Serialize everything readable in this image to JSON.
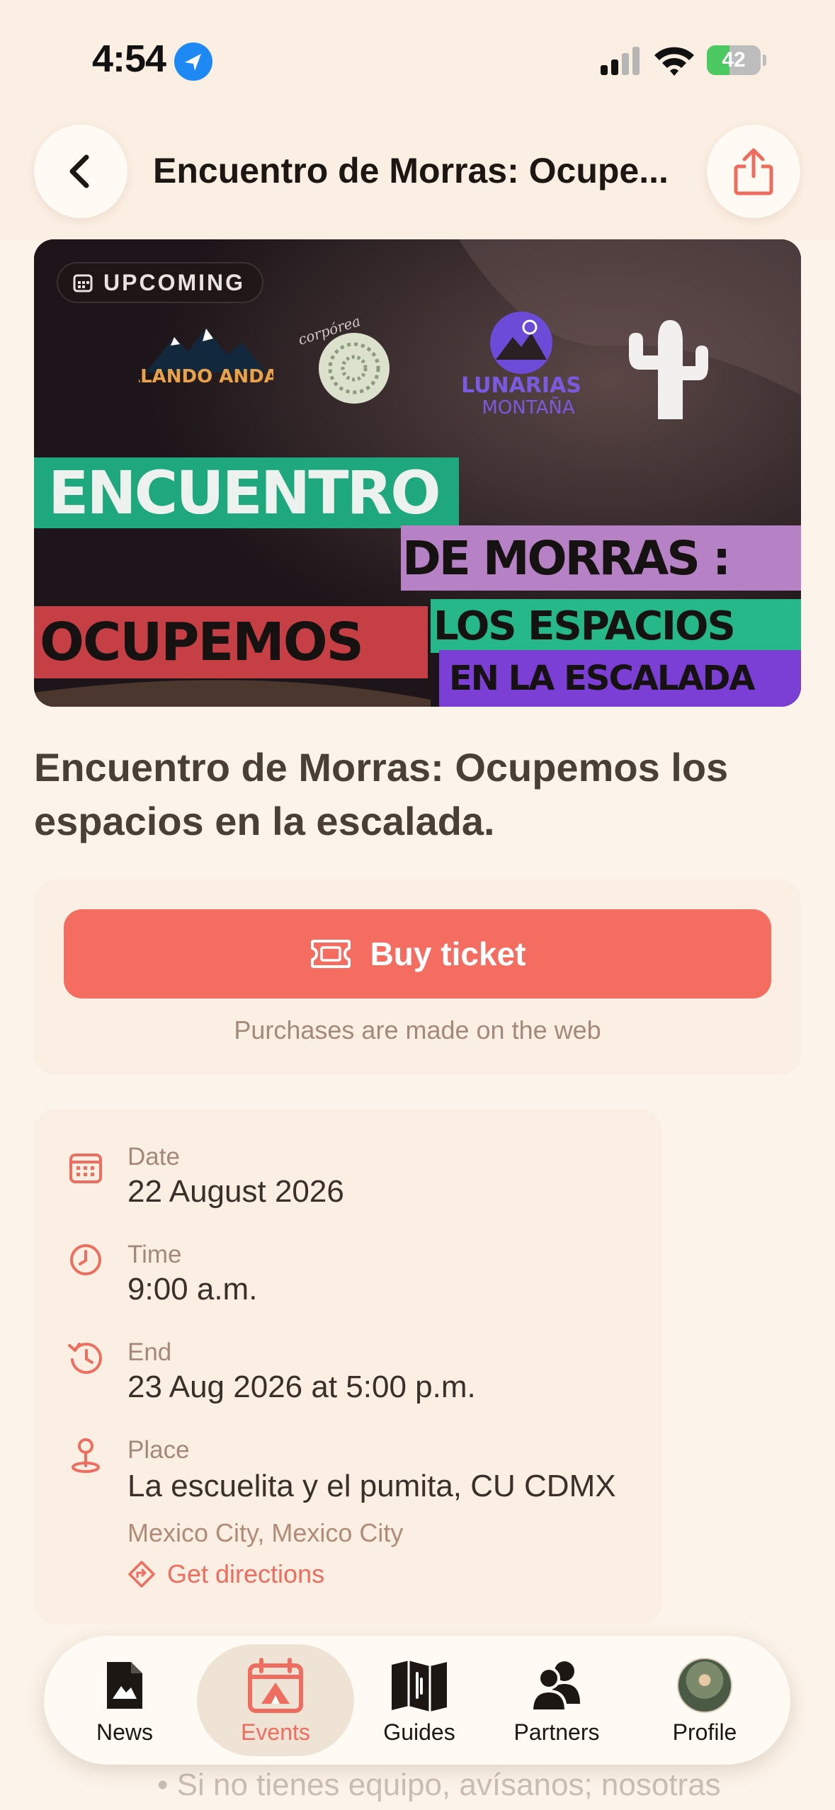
{
  "status_bar": {
    "time": "4:54",
    "battery": "42",
    "battery_level": 0.42
  },
  "header": {
    "title": "Encuentro de Morras: Ocupe..."
  },
  "hero": {
    "badge": "UPCOMING",
    "logos": {
      "escalando": "ESCALANDO ANDAMOS",
      "corporea": "corpórea",
      "lunarias_top": "LUNARIAS",
      "lunarias_bottom": "MONTAÑA"
    },
    "stripes": {
      "line1": "ENCUENTRO",
      "line2": "DE MORRAS :",
      "line3": "OCUPEMOS",
      "line4": "LOS ESPACIOS",
      "line5": "EN LA ESCALADA"
    },
    "colors": {
      "green": "#1fa77d",
      "lilac": "#b781c6",
      "red": "#c63f45",
      "teal": "#26b888",
      "purple": "#7b3fd6"
    }
  },
  "event": {
    "title": "Encuentro de Morras: Ocupemos los espacios en la escalada."
  },
  "ticket": {
    "button_label": "Buy ticket",
    "note": "Purchases are made on the web"
  },
  "details": {
    "date_label": "Date",
    "date_value": "22 August 2026",
    "time_label": "Time",
    "time_value": "9:00 a.m.",
    "end_label": "End",
    "end_value": "23 Aug 2026 at 5:00 p.m.",
    "place_label": "Place",
    "place_value": "La escuelita y el pumita, CU CDMX",
    "place_city": "Mexico City, Mexico City",
    "directions_label": "Get directions"
  },
  "peek": {
    "text": "• Si no tienes equipo, avísanos; nosotras"
  },
  "tabs": [
    {
      "label": "News",
      "icon": "news-icon"
    },
    {
      "label": "Events",
      "icon": "events-icon",
      "active": true
    },
    {
      "label": "Guides",
      "icon": "guides-icon"
    },
    {
      "label": "Partners",
      "icon": "partners-icon"
    },
    {
      "label": "Profile",
      "icon": "profile-avatar"
    }
  ],
  "theme": {
    "accent": "#f46d60",
    "background": "#fcf3ea",
    "card": "#fbefe3"
  }
}
